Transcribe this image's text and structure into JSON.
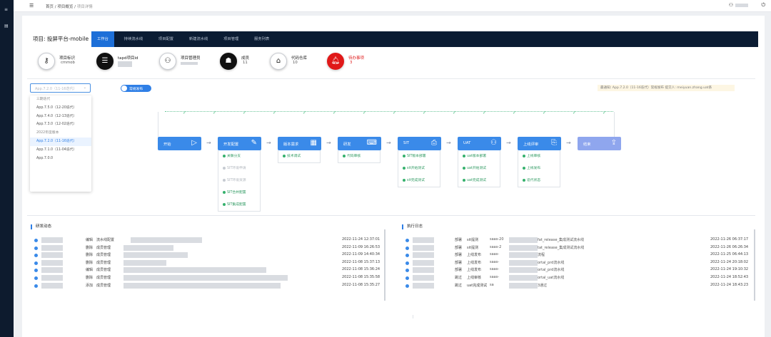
{
  "breadcrumb": {
    "home": "首页",
    "sep1": "/",
    "overview": "项目概览",
    "sep2": "/",
    "current": "项目详情"
  },
  "project": {
    "title": "项目: 投屏平台-mobile"
  },
  "tabs": [
    {
      "label": "工作台",
      "active": true
    },
    {
      "label": "持续流水线",
      "active": false
    },
    {
      "label": "项目配置",
      "active": false
    },
    {
      "label": "新建流水线",
      "active": false
    },
    {
      "label": "项目管理",
      "active": false
    },
    {
      "label": "服务列表",
      "active": false
    }
  ],
  "metrics": [
    {
      "label": "项目标识",
      "value": "cmmob",
      "icon": "key-icon",
      "style": "plain"
    },
    {
      "label": "tapd项目id",
      "value": "",
      "icon": "list-icon",
      "style": "dark"
    },
    {
      "label": "项目管理员",
      "value": "",
      "icon": "users-icon",
      "style": "plain"
    },
    {
      "label": "成员",
      "value": "11",
      "icon": "group-icon",
      "style": "dark"
    },
    {
      "label": "代码仓库",
      "value": "10",
      "icon": "home-icon",
      "style": "plain"
    },
    {
      "label": "待办事项",
      "value": "3",
      "icon": "bell-icon",
      "style": "red"
    }
  ],
  "version_select": {
    "value": "App.7.2.0（11-16迭代）"
  },
  "toggle": {
    "label": "常规发布"
  },
  "notice": "最通知: App.7.2.0（11-16迭代）常规发布 提交人: meiyuan.zhang.uat系",
  "dropdown": [
    {
      "label": "三期迭代",
      "type": "grp"
    },
    {
      "label": "App.7.5.0（12-20迭代）",
      "type": "opt"
    },
    {
      "label": "App.7.4.0（12-13迭代）",
      "type": "opt"
    },
    {
      "label": "App.7.3.0（12-02迭代）",
      "type": "opt"
    },
    {
      "label": "2022年度版本",
      "type": "grp"
    },
    {
      "label": "App.7.2.0（11-16迭代）",
      "type": "sel"
    },
    {
      "label": "App.7.1.0（11-04迭代）",
      "type": "opt"
    },
    {
      "label": "App.7.0.0",
      "type": "opt"
    }
  ],
  "stages": [
    {
      "label": "开始",
      "icon": "▷",
      "style": "blue"
    },
    {
      "label": "开发配置",
      "icon": "✎",
      "style": "blue"
    },
    {
      "label": "版本需求",
      "icon": "▦",
      "style": "blue"
    },
    {
      "label": "研发",
      "icon": "⌨",
      "style": "blue"
    },
    {
      "label": "SIT",
      "icon": "⎙",
      "style": "blue"
    },
    {
      "label": "UAT",
      "icon": "⚇",
      "style": "blue"
    },
    {
      "label": "上线评审",
      "icon": "⎘",
      "style": "blue"
    },
    {
      "label": "结束",
      "icon": "⇪",
      "style": "grey"
    }
  ],
  "substeps": {
    "dev_config": [
      {
        "label": "关联分支",
        "done": true
      },
      {
        "label": "SIT环境申请",
        "done": false
      },
      {
        "label": "SIT环境资源",
        "done": false
      },
      {
        "label": "SIT合并配置",
        "done": true
      },
      {
        "label": "SIT集成配置",
        "done": true
      }
    ],
    "requirements": [
      {
        "label": "技术调试",
        "done": true
      }
    ],
    "research": [
      {
        "label": "代码审核",
        "done": true
      }
    ],
    "sit": [
      {
        "label": "SIT版本部署",
        "done": true
      },
      {
        "label": "sit开始测试",
        "done": true
      },
      {
        "label": "sit完成测试",
        "done": true
      }
    ],
    "uat": [
      {
        "label": "uat版本部署",
        "done": true
      },
      {
        "label": "uat开始测试",
        "done": true
      },
      {
        "label": "uat完成测试",
        "done": true
      }
    ],
    "review": [
      {
        "label": "上线审核",
        "done": true
      },
      {
        "label": "上线发布",
        "done": true
      },
      {
        "label": "迭代状态",
        "done": true
      }
    ]
  },
  "panel_left": {
    "title": "研发动态",
    "rows": [
      {
        "action": "编辑",
        "target": "流水线配置",
        "time": "2022-11-24 12:37:01"
      },
      {
        "action": "删除",
        "target": "成员管理",
        "time": "2022-11-09 16:26:53"
      },
      {
        "action": "删除",
        "target": "成员管理",
        "time": "2022-11-09 14:40:34"
      },
      {
        "action": "删除",
        "target": "成员管理",
        "time": "2022-11-08 15:37:13"
      },
      {
        "action": "编辑",
        "target": "成员管理",
        "time": "2022-11-08 15:36:24"
      },
      {
        "action": "删除",
        "target": "成员管理",
        "time": "2022-11-08 15:35:58"
      },
      {
        "action": "添加",
        "target": "成员管理",
        "time": "2022-11-08 15:35:27"
      }
    ]
  },
  "panel_right": {
    "title": "执行日志",
    "rows": [
      {
        "status": "部署",
        "stage": "sit提测",
        "app": "saas-20",
        "pipeline": "fat_release_集成测试流水线",
        "time": "2022-11-26 06:37:17"
      },
      {
        "status": "部署",
        "stage": "sit提测",
        "app": "saas-2",
        "pipeline": "tat_release_集成测试流水线",
        "time": "2022-11-26 06:26:34"
      },
      {
        "status": "部署",
        "stage": "上线发布",
        "app": "saas-",
        "pipeline": "流程",
        "time": "2022-11-25 06:44:13"
      },
      {
        "status": "部署",
        "stage": "上线发布",
        "app": "saas-",
        "pipeline": "ortal_prd流水线",
        "time": "2022-11-24 20:18:02"
      },
      {
        "status": "部署",
        "stage": "上线发布",
        "app": "saas-",
        "pipeline": "ortal_prd流水线",
        "time": "2022-11-24 19:10:32"
      },
      {
        "status": "跳过",
        "stage": "上线审核",
        "app": "saas-",
        "pipeline": "ortal_uat流水线",
        "time": "2022-11-24 18:52:43"
      },
      {
        "status": "跳过",
        "stage": "uat完成测试",
        "app": "sa",
        "pipeline": "3通过",
        "time": "2022-11-24 18:43:23"
      }
    ]
  }
}
